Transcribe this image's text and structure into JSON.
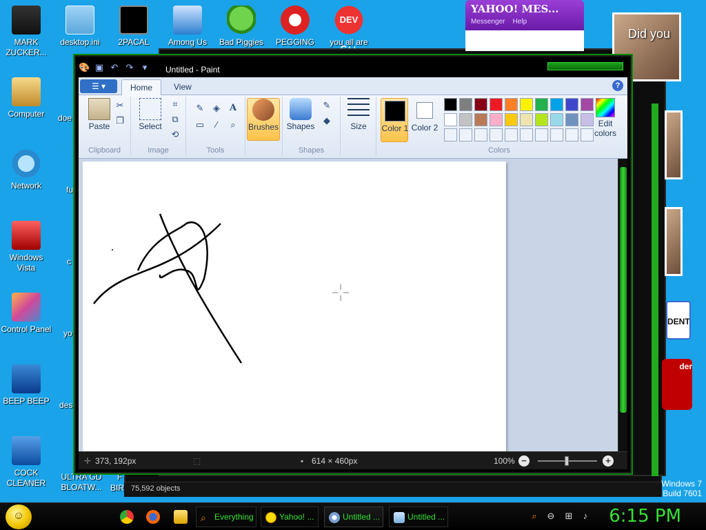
{
  "desktop": {
    "icons": [
      {
        "label": "MARK ZUCKER...",
        "icon": "person-icon"
      },
      {
        "label": "desktop.ini",
        "icon": "settings-file-icon"
      },
      {
        "label": "2PACAL",
        "icon": "command-prompt-icon"
      },
      {
        "label": "Among Us",
        "icon": "game-icon"
      },
      {
        "label": "Bad Piggies",
        "icon": "pig-icon"
      },
      {
        "label": "PEGGING",
        "icon": "peggle-icon"
      },
      {
        "label": "you all are",
        "icon": "dev-cpp-icon"
      },
      {
        "label": "Computer",
        "icon": "computer-icon"
      },
      {
        "label": "Network",
        "icon": "network-icon"
      },
      {
        "label": "Windows Vista",
        "icon": "recycle-bin-icon"
      },
      {
        "label": "Control Panel",
        "icon": "control-panel-icon"
      },
      {
        "label": "BEEP BEEP",
        "icon": "installer-icon"
      },
      {
        "label": "COCK CLEANER",
        "icon": "installer-icon"
      },
      {
        "label": "ULTRA GD BLOATW...",
        "icon": "installer-icon"
      }
    ],
    "partial_labels": [
      "doe",
      "fu",
      "c",
      "yo",
      "des",
      "F",
      "BIR"
    ],
    "dev_icon_text": "DEV C++",
    "yahoo_messenger": {
      "title": "YAHOO! MES...",
      "menu": [
        "Messenger",
        "Help"
      ]
    },
    "did_you_text": "Did you",
    "student_text": "DENT",
    "red_block_text": "der",
    "windows_version": [
      "Windows 7",
      "Build 7601"
    ],
    "explorer_status": "75,592 objects"
  },
  "paint": {
    "title": "Untitled - Paint",
    "tabs": [
      "Home",
      "View"
    ],
    "groups": {
      "clipboard": {
        "label": "Clipboard",
        "paste": "Paste"
      },
      "image": {
        "label": "Image",
        "select": "Select"
      },
      "tools": {
        "label": "Tools"
      },
      "brushes": {
        "label": "Brushes"
      },
      "shapes": {
        "label": "Shapes",
        "shapes_btn": "Shapes"
      },
      "size": {
        "label": "Size"
      },
      "colors": {
        "label": "Colors",
        "color1": "Color 1",
        "color2": "Color 2",
        "edit": "Edit colors"
      }
    },
    "color1_value": "#000000",
    "color2_value": "#ffffff",
    "palette_row1": [
      "#000000",
      "#7f7f7f",
      "#880015",
      "#ed1c24",
      "#ff7f27",
      "#fff200",
      "#22b14c",
      "#00a2e8",
      "#3f48cc",
      "#a349a4"
    ],
    "palette_row2": [
      "#ffffff",
      "#c3c3c3",
      "#b97a57",
      "#ffaec9",
      "#ffc90e",
      "#efe4b0",
      "#b5e61d",
      "#99d9ea",
      "#7092be",
      "#c8bfe7"
    ],
    "status": {
      "cursor_pos": "373, 192px",
      "canvas_size": "614 × 460px",
      "zoom": "100%"
    }
  },
  "taskbar": {
    "items": [
      "Everything",
      "Yahoo! ...",
      "Untitled ...",
      "Untitled ..."
    ],
    "clock": "6:15 PM"
  }
}
